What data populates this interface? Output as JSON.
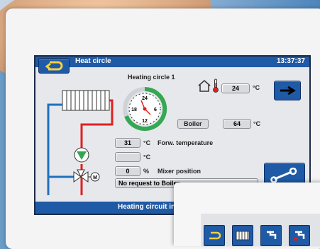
{
  "header": {
    "title": "Heat circle",
    "time": "13:37:37"
  },
  "circuit": {
    "name": "Heating circle 1"
  },
  "clock": {
    "n24": "24",
    "n6": "6",
    "n12": "12",
    "n18": "18"
  },
  "room": {
    "temp_value": "24",
    "temp_unit": "°C"
  },
  "boiler": {
    "label": "Boiler",
    "value": "64",
    "unit": "°C"
  },
  "forward": {
    "value": "31",
    "unit": "°C",
    "label": "Forw. temperature"
  },
  "second": {
    "value": "",
    "unit": "°C"
  },
  "mixer": {
    "value": "0",
    "unit": "%",
    "label": "Mixer position"
  },
  "status": {
    "request": "No request to Boiler",
    "bar": "Heating circuit in"
  },
  "valve": {
    "motor_label": "M"
  },
  "colors": {
    "accent": "#1f5aa6",
    "flow": "#e02020",
    "return": "#2070c0",
    "pump": "#2fa84f"
  }
}
